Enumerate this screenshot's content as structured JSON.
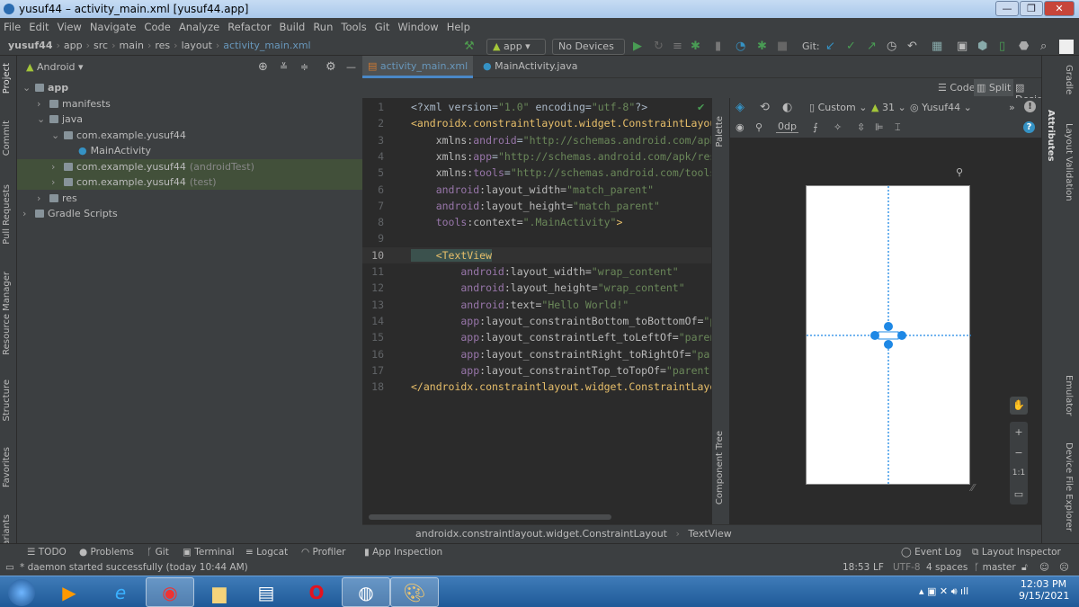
{
  "window": {
    "title": "yusuf44 – activity_main.xml [yusuf44.app]",
    "controls": [
      "—",
      "❐",
      "✕"
    ]
  },
  "menu": [
    "File",
    "Edit",
    "View",
    "Navigate",
    "Code",
    "Analyze",
    "Refactor",
    "Build",
    "Run",
    "Tools",
    "Git",
    "Window",
    "Help"
  ],
  "breadcrumb": [
    "yusuf44",
    "app",
    "src",
    "main",
    "res",
    "layout",
    "activity_main.xml"
  ],
  "toolbar": {
    "config": "app",
    "devices": "No Devices",
    "git_label": "Git:"
  },
  "left_tabs": [
    "Project",
    "Commit",
    "Pull Requests",
    "Resource Manager",
    "Structure",
    "Favorites",
    "ariants"
  ],
  "project": {
    "view": "Android",
    "tree": [
      {
        "label": "app",
        "depth": 0
      },
      {
        "label": "manifests",
        "depth": 1
      },
      {
        "label": "java",
        "depth": 1
      },
      {
        "label": "com.example.yusuf44",
        "depth": 2
      },
      {
        "label": "MainActivity",
        "depth": 3
      },
      {
        "label": "com.example.yusuf44",
        "suffix": "(androidTest)",
        "depth": 2,
        "selected": true
      },
      {
        "label": "com.example.yusuf44",
        "suffix": "(test)",
        "depth": 2,
        "selected": true
      },
      {
        "label": "res",
        "depth": 1
      },
      {
        "label": "Gradle Scripts",
        "depth": 0
      }
    ]
  },
  "tabs": [
    {
      "label": "activity_main.xml",
      "active": true
    },
    {
      "label": "MainActivity.java"
    }
  ],
  "view_modes": [
    "Code",
    "Split",
    "Design"
  ],
  "code": [
    [
      [
        "<?xml version=",
        "p"
      ],
      [
        "\"1.0\"",
        "v"
      ],
      [
        " encoding=",
        "p"
      ],
      [
        "\"utf-8\"",
        "v"
      ],
      [
        "?>",
        "p"
      ]
    ],
    [
      [
        "<androidx.constraintlayout.widget.ConstraintLayout",
        "t"
      ]
    ],
    [
      [
        "    xmlns:",
        "a"
      ],
      [
        "android",
        "ns"
      ],
      [
        "=",
        "p"
      ],
      [
        "\"http://schemas.android.com/apk/res/android\"",
        "v"
      ]
    ],
    [
      [
        "    xmlns:",
        "a"
      ],
      [
        "app",
        "ns"
      ],
      [
        "=",
        "p"
      ],
      [
        "\"http://schemas.android.com/apk/res-auto\"",
        "v"
      ]
    ],
    [
      [
        "    xmlns:",
        "a"
      ],
      [
        "tools",
        "ns"
      ],
      [
        "=",
        "p"
      ],
      [
        "\"http://schemas.android.com/tools\"",
        "v"
      ]
    ],
    [
      [
        "    android",
        "ns"
      ],
      [
        ":layout_width=",
        "a"
      ],
      [
        "\"match_parent\"",
        "v"
      ]
    ],
    [
      [
        "    android",
        "ns"
      ],
      [
        ":layout_height=",
        "a"
      ],
      [
        "\"match_parent\"",
        "v"
      ]
    ],
    [
      [
        "    tools",
        "ns"
      ],
      [
        ":context=",
        "a"
      ],
      [
        "\".MainActivity\"",
        "v"
      ],
      [
        ">",
        "t"
      ]
    ],
    [
      [
        "",
        ""
      ]
    ],
    [
      [
        "    <TextView",
        "t"
      ]
    ],
    [
      [
        "        android",
        "ns"
      ],
      [
        ":layout_width=",
        "a"
      ],
      [
        "\"wrap_content\"",
        "v"
      ]
    ],
    [
      [
        "        android",
        "ns"
      ],
      [
        ":layout_height=",
        "a"
      ],
      [
        "\"wrap_content\"",
        "v"
      ]
    ],
    [
      [
        "        android",
        "ns"
      ],
      [
        ":text=",
        "a"
      ],
      [
        "\"Hello World!\"",
        "v"
      ]
    ],
    [
      [
        "        app",
        "ns"
      ],
      [
        ":layout_constraintBottom_toBottomOf=",
        "a"
      ],
      [
        "\"parent\"",
        "v"
      ]
    ],
    [
      [
        "        app",
        "ns"
      ],
      [
        ":layout_constraintLeft_toLeftOf=",
        "a"
      ],
      [
        "\"parent\"",
        "v"
      ]
    ],
    [
      [
        "        app",
        "ns"
      ],
      [
        ":layout_constraintRight_toRightOf=",
        "a"
      ],
      [
        "\"parent\"",
        "v"
      ]
    ],
    [
      [
        "        app",
        "ns"
      ],
      [
        ":layout_constraintTop_toTopOf=",
        "a"
      ],
      [
        "\"parent\"",
        "v"
      ],
      [
        " />",
        "t"
      ]
    ],
    [
      [
        "</androidx.constraintlayout.widget.ConstraintLayout>",
        "t"
      ]
    ]
  ],
  "design": {
    "palette": "Palette",
    "component_tree": "Component Tree",
    "device": "Custom",
    "api": "31",
    "theme": "Yusuf44",
    "margin": "0dp",
    "zoom_ratio": "1:1"
  },
  "right_tabs": [
    "Gradle",
    "Attributes",
    "Layout Validation",
    "Emulator",
    "Device File Explorer"
  ],
  "editor_breadcrumb": [
    "androidx.constraintlayout.widget.ConstraintLayout",
    "TextView"
  ],
  "tool_windows": [
    "TODO",
    "Problems",
    "Git",
    "Terminal",
    "Logcat",
    "Profiler",
    "App Inspection"
  ],
  "tool_windows_right": [
    "Event Log",
    "Layout Inspector"
  ],
  "status": {
    "message": "* daemon started successfully (today 10:44 AM)",
    "position": "18:53",
    "line_sep": "LF",
    "encoding": "UTF-8",
    "indent": "4 spaces",
    "branch": "master"
  },
  "taskbar": {
    "time": "12:03 PM",
    "date": "9/15/2021"
  }
}
